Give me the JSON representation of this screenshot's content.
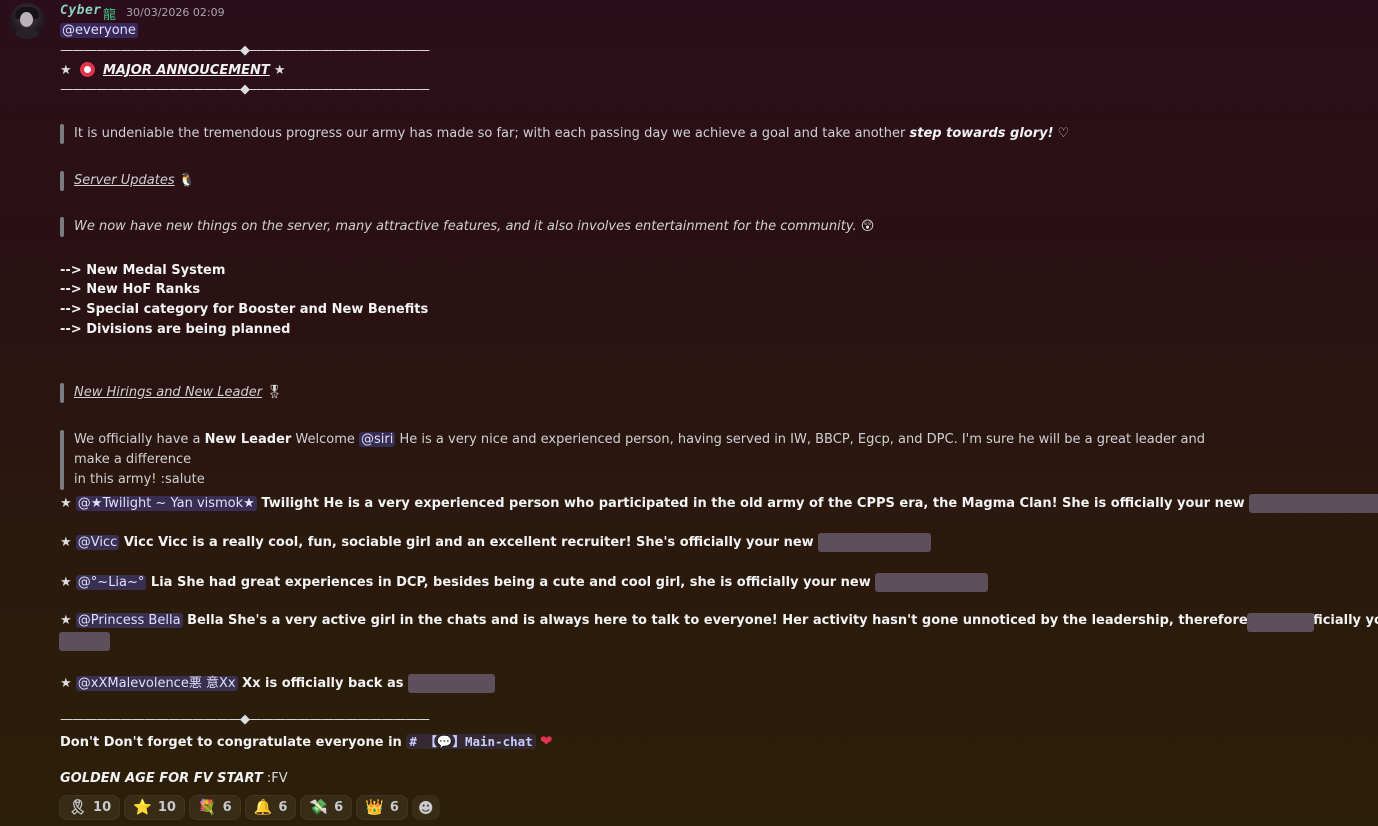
{
  "author": {
    "username": "Cyber",
    "tag_icon": "dragon-kanji-icon",
    "tag_text": "龍",
    "timestamp": "30/03/2026 02:09"
  },
  "message": {
    "everyone": "@everyone",
    "rule_line": "———————————————◆———————————————",
    "announcement_star": "★",
    "announcement_title": "MAJOR ANNOUCEMENT",
    "quote1_text": "It is undeniable the tremendous progress our army has made so far; with each passing day we achieve a goal and take another ",
    "quote1_bold": "step towards glory!",
    "server_updates_title": "Server Updates",
    "server_updates_text": "We now have new things on the server, many attractive features, and it also involves entertainment for the community.",
    "list_items": [
      "--> New Medal System",
      "--> New HoF Ranks",
      "--> Special category for Booster and New Benefits",
      "--> Divisions are being planned"
    ],
    "hirings_title": "New Hirings and New Leader",
    "leader_text_1": "We officially have a ",
    "leader_bold": "New Leader",
    "leader_text_2": " Welcome ",
    "leader_mention": "@siri",
    "leader_text_3": "  He is a very nice and experienced person, having served in IW, BBCP, Egcp, and DPC. I'm sure he will be a great leader and make a difference",
    "leader_text_4": "in this army! :salute",
    "star": "★",
    "members": [
      {
        "mention": "@★Twilight ~ Yan vismok★",
        "text": "  Twilight He is a very experienced person who participated in the old army of the CPPS era, the Magma Clan! She is officially your new "
      },
      {
        "mention": "@Vicc",
        "text": " Vicc Vicc is a really cool, fun, sociable girl and an excellent recruiter! She's officially your new "
      },
      {
        "mention": "@°~Lia~°",
        "text": " Lia She had great experiences in DCP, besides being a cute and cool girl, she is officially your new "
      },
      {
        "mention": "@Princess Bella",
        "text": " Bella She's a very active girl in the chats and is always here to talk to everyone! Her activity hasn't gone unnoticed by the leadership, therefore she is officially your new "
      },
      {
        "mention": "@xXMalevolence悪 意Xx",
        "text": " Xx is officially back as "
      }
    ],
    "congrats_text": "Don't Don't forget to congratulate everyone in ",
    "channel_hash": "#",
    "channel_name": "【💬】Main-chat",
    "golden_age": "GOLDEN AGE FOR FV START",
    "golden_age_suffix": " :FV"
  },
  "reactions": [
    {
      "icon": "ribbon-icon",
      "glyph": "🎗",
      "count": "10"
    },
    {
      "icon": "star-icon",
      "glyph": "⭐",
      "count": "10"
    },
    {
      "icon": "bouquet-icon",
      "glyph": "💐",
      "count": "6"
    },
    {
      "icon": "bell-icon",
      "glyph": "🔔",
      "count": "6"
    },
    {
      "icon": "money-icon",
      "glyph": "💸",
      "count": "6"
    },
    {
      "icon": "crown-icon",
      "glyph": "👑",
      "count": "6"
    }
  ],
  "colors": {
    "mention_bg": "#5865f2",
    "username": "#8ecfc3",
    "spoiler": "#5d4f5c",
    "heart_red": "#e0344f"
  }
}
